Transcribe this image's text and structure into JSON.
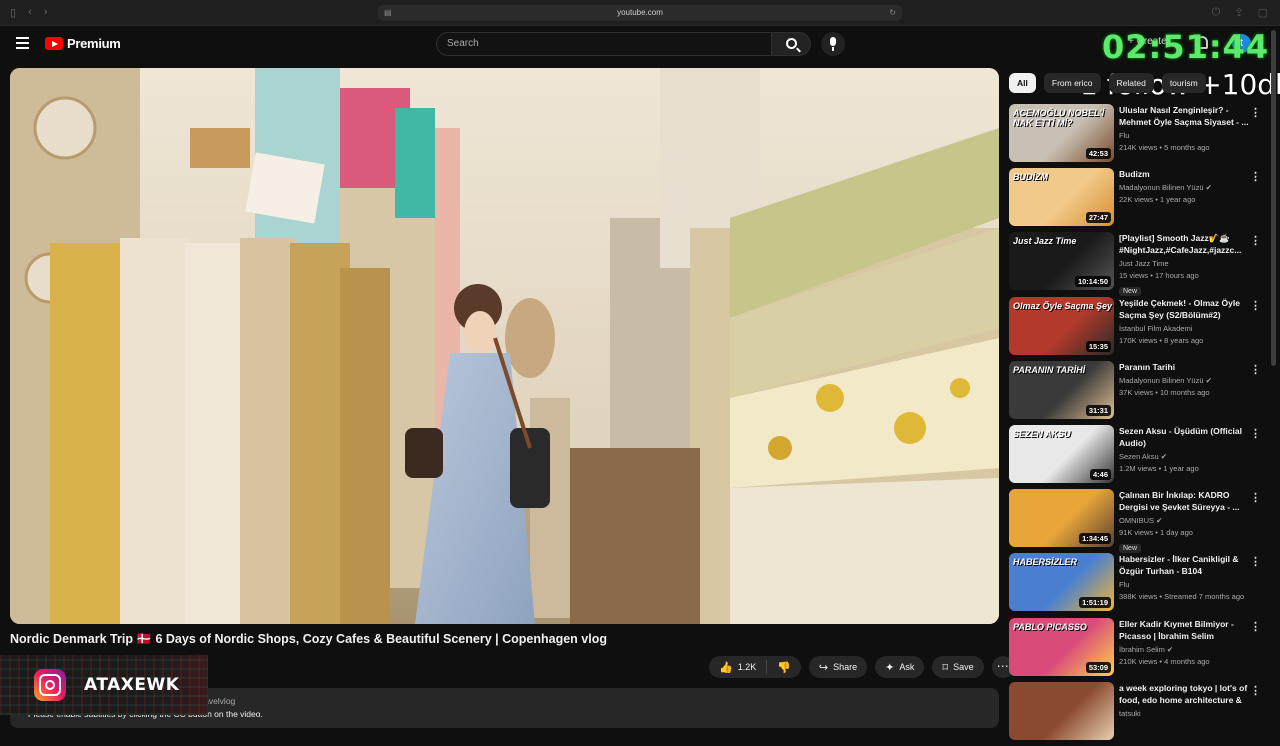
{
  "browser": {
    "url": "youtube.com"
  },
  "header": {
    "brand": "Premium",
    "search_placeholder": "Search",
    "create_label": "+ Create",
    "avatar_letter": "t"
  },
  "overlay": {
    "clock": "02:51:44",
    "follow": "1 follow +10dk",
    "instagram": "ATAXEWK"
  },
  "video": {
    "title": "Nordic Denmark Trip 🇩🇰 6 Days of Nordic Shops, Cozy Cafes & Beautiful Scenery | Copenhagen vlog",
    "likes": "1.2K",
    "share": "Share",
    "ask": "Ask",
    "save": "Save",
    "tags": "ark #travelvlog",
    "subtitle_notice": "Please enable subtitles by clicking the CC button on the video."
  },
  "chips": [
    "All",
    "From erico",
    "hos",
    "Related",
    "tourism"
  ],
  "recommendations": [
    {
      "title": "Uluslar Nasıl Zenginleşir? - Mehmet Öyle Saçma Siyaset - ...",
      "channel": "Flu",
      "meta": "214K views • 5 months ago",
      "duration": "42:53",
      "thumb_text": "ACEMOĞLU NOBEL'İ NAK ETTİ Mİ?",
      "bg": "#c8c0b4",
      "accent": "#7a4a2a"
    },
    {
      "title": "Budizm",
      "channel": "Madalyonun Bilinen Yüzü ✔",
      "meta": "22K views • 1 year ago",
      "duration": "27:47",
      "thumb_text": "BUDİZM",
      "bg": "#f1c98a",
      "accent": "#d98f2b"
    },
    {
      "title": "[Playlist] Smooth Jazz🎷☕ #NightJazz,#CafeJazz,#jazzc...",
      "channel": "Just Jazz Time",
      "meta": "15 views • 17 hours ago",
      "duration": "10:14:50",
      "thumb_text": "Just Jazz Time",
      "bg": "#1a1a1a",
      "accent": "#555",
      "badge": "New"
    },
    {
      "title": "Yeşilde Çekmek! - Olmaz Öyle Saçma Şey (S2/Bölüm#2)",
      "channel": "İstanbul Film Akademi",
      "meta": "170K views • 8 years ago",
      "duration": "15:35",
      "thumb_text": "Olmaz Öyle Saçma Şey",
      "bg": "#b33a2a",
      "accent": "#2a2a2a"
    },
    {
      "title": "Paranın Tarihi",
      "channel": "Madalyonun Bilinen Yüzü ✔",
      "meta": "37K views • 10 months ago",
      "duration": "31:31",
      "thumb_text": "PARANIN TARİHİ",
      "bg": "#3a3a3a",
      "accent": "#e0c090"
    },
    {
      "title": "Sezen Aksu - Üşüdüm (Official Audio)",
      "channel": "Sezen Aksu ✔",
      "meta": "1.2M views • 1 year ago",
      "duration": "4:46",
      "thumb_text": "SEZEN AKSU",
      "bg": "#e8e8e8",
      "accent": "#333"
    },
    {
      "title": "Çalınan Bir İnkılap: KADRO Dergisi ve Şevket Süreyya - ...",
      "channel": "OMNIBUS ✔",
      "meta": "91K views • 1 day ago",
      "duration": "1:34:45",
      "thumb_text": "",
      "bg": "#e8a63a",
      "accent": "#5a4030",
      "badge": "New"
    },
    {
      "title": "Habersizler - İlker Canikligil & Özgür Turhan - B104",
      "channel": "Flu",
      "meta": "388K views • Streamed 7 months ago",
      "duration": "1:51:19",
      "thumb_text": "HABERSİZLER",
      "bg": "#4a7fd0",
      "accent": "#f2b634"
    },
    {
      "title": "Eller Kadir Kıymet Bilmiyor - Picasso | İbrahim Selim",
      "channel": "İbrahim Selim ✔",
      "meta": "210K views • 4 months ago",
      "duration": "53:09",
      "thumb_text": "PABLO PICASSO",
      "bg": "#d94c7a",
      "accent": "#ffd24a"
    },
    {
      "title": "a week exploring tokyo | lot's of food, edo home architecture & ...",
      "channel": "tatsuki",
      "meta": "",
      "duration": "",
      "thumb_text": "",
      "bg": "#8a4a30",
      "accent": "#e8d0b0"
    }
  ],
  "colors": {
    "accent_red": "#ff0000",
    "clock_green": "#5de86e",
    "background": "#0f0f0f"
  }
}
